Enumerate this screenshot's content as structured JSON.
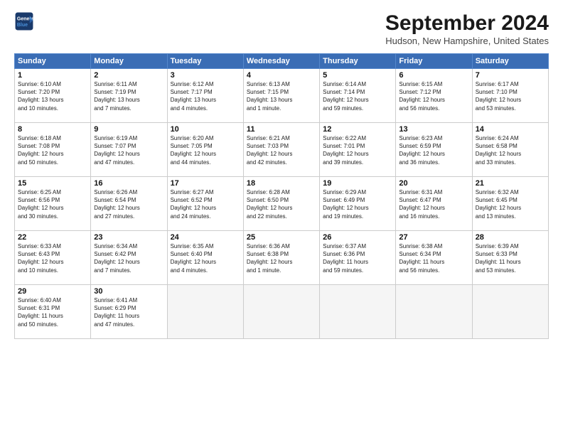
{
  "header": {
    "logo_line1": "General",
    "logo_line2": "Blue",
    "month_title": "September 2024",
    "location": "Hudson, New Hampshire, United States"
  },
  "weekdays": [
    "Sunday",
    "Monday",
    "Tuesday",
    "Wednesday",
    "Thursday",
    "Friday",
    "Saturday"
  ],
  "weeks": [
    [
      {
        "day": "1",
        "info": "Sunrise: 6:10 AM\nSunset: 7:20 PM\nDaylight: 13 hours\nand 10 minutes."
      },
      {
        "day": "2",
        "info": "Sunrise: 6:11 AM\nSunset: 7:19 PM\nDaylight: 13 hours\nand 7 minutes."
      },
      {
        "day": "3",
        "info": "Sunrise: 6:12 AM\nSunset: 7:17 PM\nDaylight: 13 hours\nand 4 minutes."
      },
      {
        "day": "4",
        "info": "Sunrise: 6:13 AM\nSunset: 7:15 PM\nDaylight: 13 hours\nand 1 minute."
      },
      {
        "day": "5",
        "info": "Sunrise: 6:14 AM\nSunset: 7:14 PM\nDaylight: 12 hours\nand 59 minutes."
      },
      {
        "day": "6",
        "info": "Sunrise: 6:15 AM\nSunset: 7:12 PM\nDaylight: 12 hours\nand 56 minutes."
      },
      {
        "day": "7",
        "info": "Sunrise: 6:17 AM\nSunset: 7:10 PM\nDaylight: 12 hours\nand 53 minutes."
      }
    ],
    [
      {
        "day": "8",
        "info": "Sunrise: 6:18 AM\nSunset: 7:08 PM\nDaylight: 12 hours\nand 50 minutes."
      },
      {
        "day": "9",
        "info": "Sunrise: 6:19 AM\nSunset: 7:07 PM\nDaylight: 12 hours\nand 47 minutes."
      },
      {
        "day": "10",
        "info": "Sunrise: 6:20 AM\nSunset: 7:05 PM\nDaylight: 12 hours\nand 44 minutes."
      },
      {
        "day": "11",
        "info": "Sunrise: 6:21 AM\nSunset: 7:03 PM\nDaylight: 12 hours\nand 42 minutes."
      },
      {
        "day": "12",
        "info": "Sunrise: 6:22 AM\nSunset: 7:01 PM\nDaylight: 12 hours\nand 39 minutes."
      },
      {
        "day": "13",
        "info": "Sunrise: 6:23 AM\nSunset: 6:59 PM\nDaylight: 12 hours\nand 36 minutes."
      },
      {
        "day": "14",
        "info": "Sunrise: 6:24 AM\nSunset: 6:58 PM\nDaylight: 12 hours\nand 33 minutes."
      }
    ],
    [
      {
        "day": "15",
        "info": "Sunrise: 6:25 AM\nSunset: 6:56 PM\nDaylight: 12 hours\nand 30 minutes."
      },
      {
        "day": "16",
        "info": "Sunrise: 6:26 AM\nSunset: 6:54 PM\nDaylight: 12 hours\nand 27 minutes."
      },
      {
        "day": "17",
        "info": "Sunrise: 6:27 AM\nSunset: 6:52 PM\nDaylight: 12 hours\nand 24 minutes."
      },
      {
        "day": "18",
        "info": "Sunrise: 6:28 AM\nSunset: 6:50 PM\nDaylight: 12 hours\nand 22 minutes."
      },
      {
        "day": "19",
        "info": "Sunrise: 6:29 AM\nSunset: 6:49 PM\nDaylight: 12 hours\nand 19 minutes."
      },
      {
        "day": "20",
        "info": "Sunrise: 6:31 AM\nSunset: 6:47 PM\nDaylight: 12 hours\nand 16 minutes."
      },
      {
        "day": "21",
        "info": "Sunrise: 6:32 AM\nSunset: 6:45 PM\nDaylight: 12 hours\nand 13 minutes."
      }
    ],
    [
      {
        "day": "22",
        "info": "Sunrise: 6:33 AM\nSunset: 6:43 PM\nDaylight: 12 hours\nand 10 minutes."
      },
      {
        "day": "23",
        "info": "Sunrise: 6:34 AM\nSunset: 6:42 PM\nDaylight: 12 hours\nand 7 minutes."
      },
      {
        "day": "24",
        "info": "Sunrise: 6:35 AM\nSunset: 6:40 PM\nDaylight: 12 hours\nand 4 minutes."
      },
      {
        "day": "25",
        "info": "Sunrise: 6:36 AM\nSunset: 6:38 PM\nDaylight: 12 hours\nand 1 minute."
      },
      {
        "day": "26",
        "info": "Sunrise: 6:37 AM\nSunset: 6:36 PM\nDaylight: 11 hours\nand 59 minutes."
      },
      {
        "day": "27",
        "info": "Sunrise: 6:38 AM\nSunset: 6:34 PM\nDaylight: 11 hours\nand 56 minutes."
      },
      {
        "day": "28",
        "info": "Sunrise: 6:39 AM\nSunset: 6:33 PM\nDaylight: 11 hours\nand 53 minutes."
      }
    ],
    [
      {
        "day": "29",
        "info": "Sunrise: 6:40 AM\nSunset: 6:31 PM\nDaylight: 11 hours\nand 50 minutes."
      },
      {
        "day": "30",
        "info": "Sunrise: 6:41 AM\nSunset: 6:29 PM\nDaylight: 11 hours\nand 47 minutes."
      },
      {
        "day": "",
        "info": ""
      },
      {
        "day": "",
        "info": ""
      },
      {
        "day": "",
        "info": ""
      },
      {
        "day": "",
        "info": ""
      },
      {
        "day": "",
        "info": ""
      }
    ]
  ]
}
